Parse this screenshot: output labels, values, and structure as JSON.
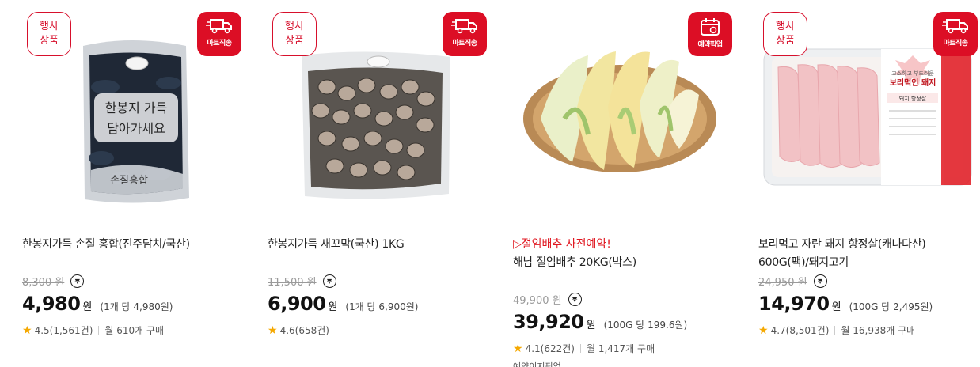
{
  "products": [
    {
      "event_badge": [
        "행사",
        "상품"
      ],
      "delivery_badge": "마트직송",
      "promo": "",
      "name": "한봉지가득 손질 홍합(진주담치/국산)",
      "original_price": "8,300 원",
      "price": "4,980",
      "currency": "원",
      "unit_price": "(1개 당 4,980원)",
      "rating": "4.5(1,561건)",
      "purchases": "월 610개 구매",
      "bag_text": [
        "한봉지 가득",
        "담아가세요"
      ],
      "bag_bottom_text": "손질홍합"
    },
    {
      "event_badge": [
        "행사",
        "상품"
      ],
      "delivery_badge": "마트직송",
      "promo": "",
      "name": "한봉지가득 새꼬막(국산) 1KG",
      "original_price": "11,500 원",
      "price": "6,900",
      "currency": "원",
      "unit_price": "(1개 당 6,900원)",
      "rating": "4.6(658건)",
      "purchases": ""
    },
    {
      "event_badge": [],
      "delivery_badge": "예약픽업",
      "promo": "▷절임배추 사전예약!",
      "name": "해남 절임배추 20KG(박스)",
      "original_price": "49,900 원",
      "price": "39,920",
      "currency": "원",
      "unit_price": "(100G 당 199.6원)",
      "rating": "4.1(622건)",
      "purchases": "월 1,417개 구매",
      "extra_tag": "예약이지픽업"
    },
    {
      "event_badge": [
        "행사",
        "상품"
      ],
      "delivery_badge": "마트직송",
      "promo": "",
      "name": "보리먹고 자란 돼지 항정살(캐나다산) 600G(팩)/돼지고기",
      "original_price": "24,950 원",
      "price": "14,970",
      "currency": "원",
      "unit_price": "(100G 당 2,495원)",
      "rating": "4.7(8,501건)",
      "purchases": "월 16,938개 구매",
      "label_text": [
        "고소하고 부드러운",
        "보리먹인 돼지",
        "돼지 항정살"
      ]
    }
  ],
  "colors": {
    "accent_red": "#dc0e25",
    "star": "#f5a800",
    "promo_red": "#e0161f"
  }
}
